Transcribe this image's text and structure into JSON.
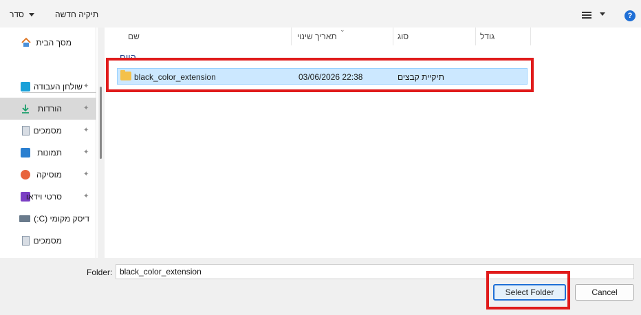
{
  "toolbar": {
    "organize_label": "סדר",
    "new_folder_label": "תיקיה חדשה",
    "help_icon": "?"
  },
  "nav": {
    "items": [
      {
        "label": "מסך הבית",
        "icon": "home-icon",
        "pinned": false
      },
      {
        "label": "שולחן העבודה",
        "icon": "desktop-icon",
        "pinned": true
      },
      {
        "label": "הורדות",
        "icon": "download-icon",
        "pinned": true,
        "selected": true
      },
      {
        "label": "מסמכים",
        "icon": "documents-icon",
        "pinned": true
      },
      {
        "label": "תמונות",
        "icon": "pictures-icon",
        "pinned": true
      },
      {
        "label": "מוסיקה",
        "icon": "music-icon",
        "pinned": true
      },
      {
        "label": "סרטי וידאו",
        "icon": "videos-icon",
        "pinned": true
      },
      {
        "label": "דיסק מקומי (C:)",
        "icon": "drive-icon",
        "pinned": false
      },
      {
        "label": "מסמכים",
        "icon": "documents-icon",
        "pinned": false
      }
    ],
    "pin_glyph": "📌"
  },
  "columns": {
    "name": "שם",
    "date": "תאריך שינוי",
    "type": "סוג",
    "size": "גודל"
  },
  "group": {
    "label": "היום"
  },
  "files": [
    {
      "name": "black_color_extension",
      "date": "03/06/2026 22:38",
      "type": "תיקיית קבצים"
    }
  ],
  "bottom": {
    "folder_label": "Folder:",
    "folder_value": "black_color_extension",
    "select_button": "Select Folder",
    "cancel_button": "Cancel"
  },
  "colors": {
    "accent": "#1f6fd6",
    "selection": "#cce8ff",
    "highlight_box": "#e01b1b"
  }
}
